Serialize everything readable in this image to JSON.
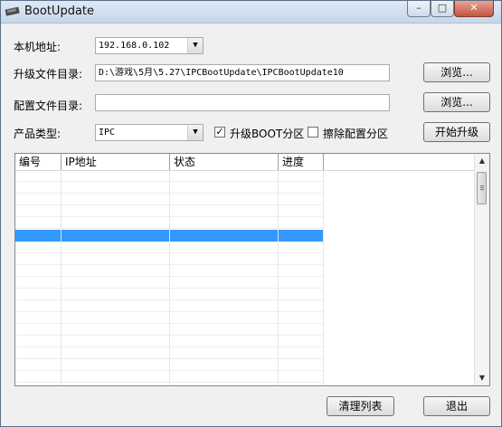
{
  "window": {
    "title": "BootUpdate",
    "controls": {
      "minimize": "–",
      "maximize": "□",
      "close": "✕"
    }
  },
  "form": {
    "ip_label": "本机地址:",
    "ip_value": "192.168.0.102",
    "upgrade_dir_label": "升级文件目录:",
    "upgrade_dir_value": "D:\\游戏\\5月\\5.27\\IPCBootUpdate\\IPCBootUpdate10",
    "config_dir_label": "配置文件目录:",
    "config_dir_value": "",
    "product_label": "产品类型:",
    "product_value": "IPC",
    "browse_label": "浏览...",
    "upgrade_boot_label": "升级BOOT分区",
    "upgrade_boot_checked": "✓",
    "erase_config_label": "擦除配置分区",
    "start_label": "开始升级"
  },
  "table": {
    "columns": [
      "编号",
      "IP地址",
      "状态",
      "进度"
    ],
    "rows": [],
    "selected_row": 6
  },
  "footer": {
    "clear_label": "清理列表",
    "exit_label": "退出"
  },
  "colors": {
    "selection": "#3399ff",
    "title_gradient_top": "#dfe9f5",
    "close_button": "#c45541"
  }
}
